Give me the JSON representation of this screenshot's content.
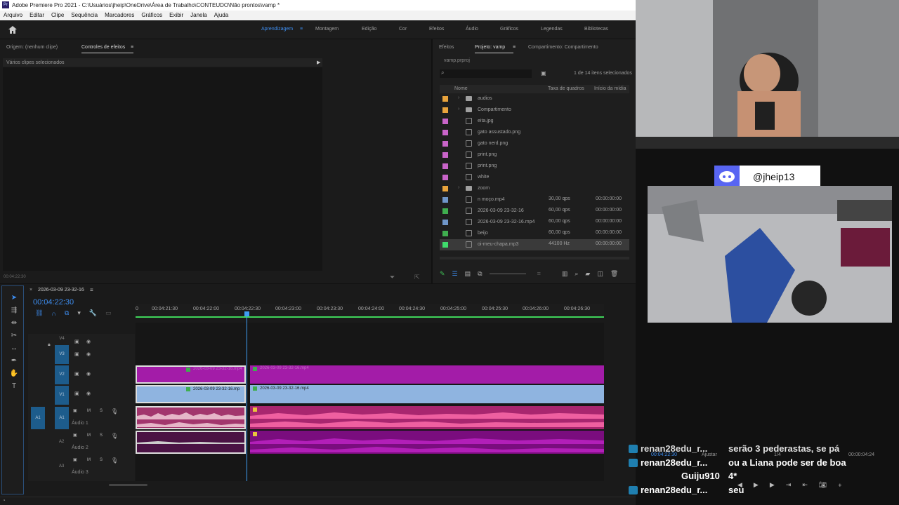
{
  "titlebar": {
    "title": "Adobe Premiere Pro 2021 - C:\\Usuários\\jheip\\OneDrive\\Área de Trabalho\\CONTEUDO\\Não prontos\\vamp *",
    "logo": "Pr"
  },
  "menu": [
    "Arquivo",
    "Editar",
    "Clipe",
    "Sequência",
    "Marcadores",
    "Gráficos",
    "Exibir",
    "Janela",
    "Ajuda"
  ],
  "workspaces": {
    "items": [
      "Aprendizagem",
      "Montagem",
      "Edição",
      "Cor",
      "Efeitos",
      "Áudio",
      "Gráficos",
      "Legendas",
      "Bibliotecas"
    ],
    "active": "Aprendizagem"
  },
  "source_panel": {
    "tab_origin": "Origem: (nenhum clipe)",
    "tab_effects": "Controles de efeitos",
    "info": "Vários clipes selecionados",
    "timecode": "00:04:22:30"
  },
  "project_panel": {
    "tab_effects": "Efeitos",
    "tab_project": "Projeto: vamp",
    "tab_shared": "Compartimento: Compartimento",
    "project_file": "vamp.prproj",
    "selection_count": "1 de 14 itens selecionados",
    "col_name": "Nome",
    "col_framerate": "Taxa de quadros",
    "col_start": "Início da mídia",
    "items": [
      {
        "name": "audios",
        "type": "folder",
        "color": "#e8a33c",
        "rate": "",
        "start": ""
      },
      {
        "name": "Compartimento",
        "type": "folder",
        "color": "#e8a33c",
        "rate": "",
        "start": ""
      },
      {
        "name": "eita.jpg",
        "type": "image",
        "color": "#c964c9",
        "rate": "",
        "start": ""
      },
      {
        "name": "gato assustado.png",
        "type": "image",
        "color": "#c964c9",
        "rate": "",
        "start": ""
      },
      {
        "name": "gato nerd.png",
        "type": "image",
        "color": "#c964c9",
        "rate": "",
        "start": ""
      },
      {
        "name": "print.png",
        "type": "image",
        "color": "#c964c9",
        "rate": "",
        "start": ""
      },
      {
        "name": "print.png",
        "type": "image",
        "color": "#c964c9",
        "rate": "",
        "start": ""
      },
      {
        "name": "white",
        "type": "image",
        "color": "#c964c9",
        "rate": "",
        "start": ""
      },
      {
        "name": "zoom",
        "type": "folder",
        "color": "#e8a33c",
        "rate": "",
        "start": ""
      },
      {
        "name": "n moço.mp4",
        "type": "video",
        "color": "#6f96c9",
        "rate": "30,00 qps",
        "start": "00:00:00:00"
      },
      {
        "name": "2026-03-09 23-32-16",
        "type": "sequence",
        "color": "#3fae4f",
        "rate": "60,00 qps",
        "start": "00:00:00:00"
      },
      {
        "name": "2026-03-09 23-32-16.mp4",
        "type": "video",
        "color": "#6f96c9",
        "rate": "60,00 qps",
        "start": "00:00:00:00"
      },
      {
        "name": "beijo",
        "type": "sequence",
        "color": "#3fae4f",
        "rate": "60,00 qps",
        "start": "00:00:00:00"
      },
      {
        "name": "oi-meu-chapa.mp3",
        "type": "audio",
        "color": "#3fdc6c",
        "rate": "44100 Hz",
        "start": "00:00:00:00",
        "selected": true
      }
    ]
  },
  "timeline": {
    "sequence_name": "2026-03-09 23-32-16",
    "timecode": "00:04:22:30",
    "ruler": [
      "0",
      "00:04:21:30",
      "00:04:22:00",
      "00:04:22:30",
      "00:04:23:00",
      "00:04:23:30",
      "00:04:24:00",
      "00:04:24:30",
      "00:04:25:00",
      "00:04:25:30",
      "00:04:26:00",
      "00:04:26:30"
    ],
    "video_tracks": [
      "V4",
      "V3",
      "V2",
      "V1"
    ],
    "audio_tracks": [
      {
        "id": "A1",
        "name": "Áudio 1"
      },
      {
        "id": "A2",
        "name": "Áudio 2"
      },
      {
        "id": "A3",
        "name": "Áudio 3"
      }
    ],
    "source_patch": "A1",
    "mute_label": "M",
    "solo_label": "S",
    "clips": {
      "v2_left": "2026-03-09 23-32-16.mp4",
      "v2_right": "2026-03-09 23-32-16.mp4",
      "v1_left": "2026-03-09 23-32-16.mp",
      "v1_right": "2026-03-09 23-32-16.mp4"
    }
  },
  "program_monitor": {
    "timecode": "00:04:22:30",
    "fit": "Ajustar",
    "ratio": "1/4",
    "duration": "00:00:04:24"
  },
  "overlay": {
    "discord_handle": "@jheip13",
    "chat": [
      {
        "user": "renan28edu_r...",
        "msg": "serão 3 pederastas, se pá"
      },
      {
        "user": "renan28edu_r...",
        "msg": "ou a Liana pode ser de boa"
      },
      {
        "user": "Guiju910",
        "msg": "4*"
      },
      {
        "user": "renan28edu_r...",
        "msg": "seu"
      }
    ]
  },
  "colors": {
    "accent": "#3d8df0",
    "video_clip": "#a31ca8",
    "audio_clip": "#e0468f",
    "v1_clip": "#8fb4e0",
    "playhead": "#3f9df3"
  }
}
